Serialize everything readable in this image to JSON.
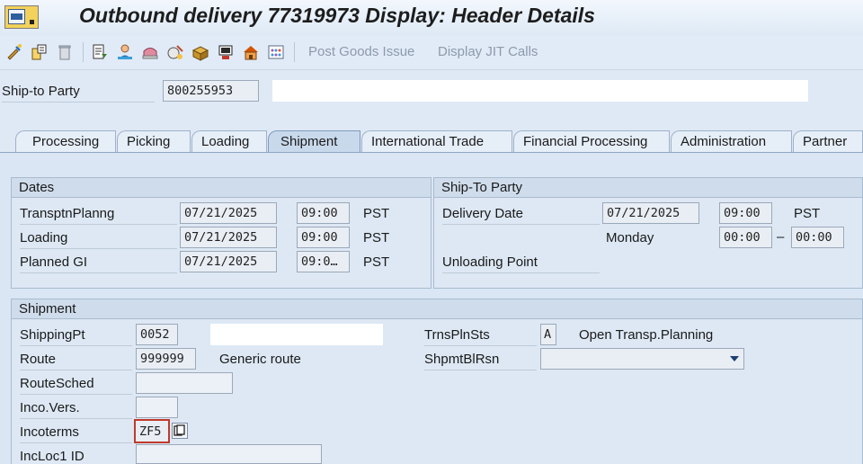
{
  "window": {
    "title": "Outbound delivery 77319973 Display: Header Details"
  },
  "toolbar": {
    "icons": [
      "change-icon",
      "other-delivery-icon",
      "delete-icon",
      "header-details-icon",
      "partner-icon",
      "texts-icon",
      "dates-icon",
      "goods-icon",
      "packing-icon",
      "warehouse-icon",
      "grid-icon"
    ],
    "post_goods_issue": "Post Goods Issue",
    "display_jit_calls": "Display JIT Calls"
  },
  "header": {
    "ship_to_label": "Ship-to Party",
    "ship_to_value": "800255953",
    "ship_to_name": ""
  },
  "tabs": [
    {
      "label": "Processing"
    },
    {
      "label": "Picking"
    },
    {
      "label": "Loading"
    },
    {
      "label": "Shipment"
    },
    {
      "label": "International Trade"
    },
    {
      "label": "Financial Processing"
    },
    {
      "label": "Administration"
    },
    {
      "label": "Partner"
    }
  ],
  "active_tab": "Shipment",
  "dates": {
    "title": "Dates",
    "rows": [
      {
        "label": "TransptnPlanng",
        "date": "07/21/2025",
        "time": "09:00",
        "tz": "PST"
      },
      {
        "label": "Loading",
        "date": "07/21/2025",
        "time": "09:00",
        "tz": "PST"
      },
      {
        "label": "Planned GI",
        "date": "07/21/2025",
        "time": "09:0…",
        "tz": "PST"
      }
    ]
  },
  "shipto": {
    "title": "Ship-To Party",
    "delivery_date_label": "Delivery Date",
    "delivery_date": "07/21/2025",
    "delivery_time": "09:00",
    "tz": "PST",
    "weekday": "Monday",
    "time_from": "00:00",
    "dash": "–",
    "time_to": "00:00",
    "unloading_point_label": "Unloading Point"
  },
  "shipment": {
    "title": "Shipment",
    "shipping_pt_label": "ShippingPt",
    "shipping_pt": "0052",
    "shipping_pt_desc": "",
    "route_label": "Route",
    "route": "999999",
    "route_desc": "Generic route",
    "route_sched_label": "RouteSched",
    "route_sched": "",
    "inco_vers_label": "Inco.Vers.",
    "inco_vers": "",
    "incoterms_label": "Incoterms",
    "incoterms": "ZF5",
    "incloc1_label": "IncLoc1 ID",
    "incloc1": "",
    "trns_pln_sts_label": "TrnsPlnSts",
    "trns_pln_sts": "A",
    "trns_pln_sts_desc": "Open Transp.Planning",
    "shpmt_blrsn_label": "ShpmtBlRsn",
    "shpmt_blrsn": ""
  }
}
